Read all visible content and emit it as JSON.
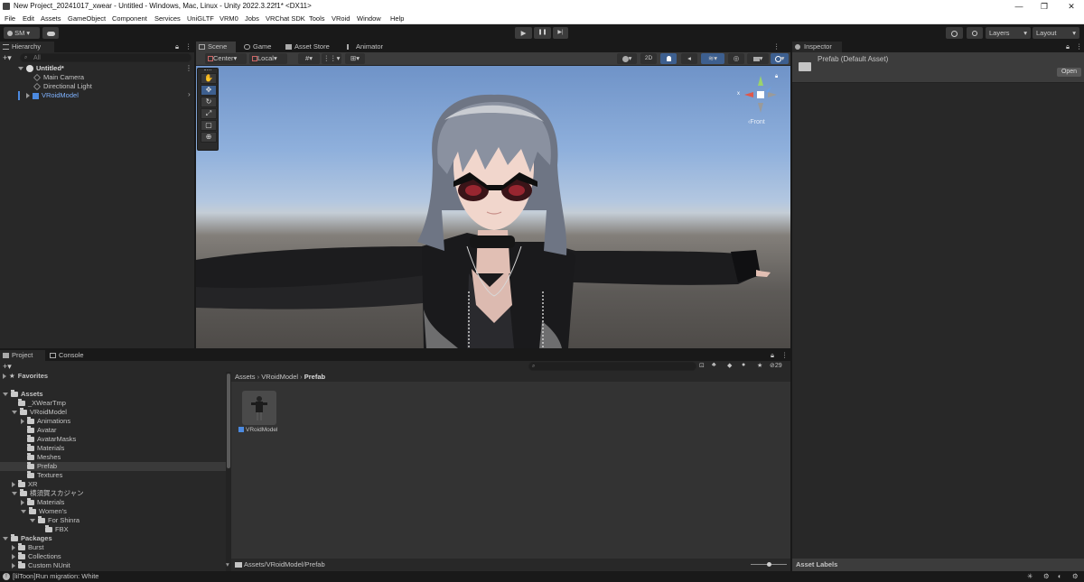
{
  "window": {
    "title": "New Project_20241017_xwear - Untitled - Windows, Mac, Linux - Unity 2022.3.22f1* <DX11>",
    "controls": [
      "—",
      "❐",
      "✕"
    ]
  },
  "menu": [
    "File",
    "Edit",
    "Assets",
    "GameObject",
    "Component",
    "Services",
    "UniGLTF",
    "VRM0",
    "Jobs",
    "VRChat SDK",
    "Tools",
    "VRoid",
    "Window",
    "Help"
  ],
  "toolbar": {
    "account": "SM",
    "cloud_icon": "cloud-icon",
    "play_icon": "▶",
    "pause_icon": "❚❚",
    "step_icon": "▶|",
    "history_icon": "history-icon",
    "search_icon": "search-icon",
    "layers": "Layers",
    "layout": "Layout"
  },
  "hierarchy": {
    "tab": "Hierarchy",
    "search_placeholder": "All",
    "scene": "Untitled*",
    "items": [
      "Main Camera",
      "Directional Light",
      "VRoidModel"
    ]
  },
  "scene_tabs": [
    "Scene",
    "Game",
    "Asset Store",
    "Animator"
  ],
  "scene_toolbar": {
    "pivot": "Center",
    "space": "Local",
    "mode_2d": "2D"
  },
  "gizmo": {
    "label": "Front",
    "x_label": "x"
  },
  "inspector": {
    "tab": "Inspector",
    "title": "Prefab (Default Asset)",
    "open_button": "Open",
    "asset_labels": "Asset Labels"
  },
  "project": {
    "tabs": [
      "Project",
      "Console"
    ],
    "favorites": "Favorites",
    "tree": [
      {
        "label": "Assets",
        "indent": 0,
        "fold": "open",
        "bold": true
      },
      {
        "label": "_XWearTmp",
        "indent": 1,
        "fold": "none"
      },
      {
        "label": "VRoidModel",
        "indent": 1,
        "fold": "open"
      },
      {
        "label": "Animations",
        "indent": 2,
        "fold": "closed"
      },
      {
        "label": "Avatar",
        "indent": 2,
        "fold": "none"
      },
      {
        "label": "AvatarMasks",
        "indent": 2,
        "fold": "none"
      },
      {
        "label": "Materials",
        "indent": 2,
        "fold": "none"
      },
      {
        "label": "Meshes",
        "indent": 2,
        "fold": "none"
      },
      {
        "label": "Prefab",
        "indent": 2,
        "fold": "none",
        "selected": true
      },
      {
        "label": "Textures",
        "indent": 2,
        "fold": "none"
      },
      {
        "label": "XR",
        "indent": 1,
        "fold": "closed"
      },
      {
        "label": "横須賀スカジャン",
        "indent": 1,
        "fold": "open"
      },
      {
        "label": "Materials",
        "indent": 2,
        "fold": "closed"
      },
      {
        "label": "Women's",
        "indent": 2,
        "fold": "open"
      },
      {
        "label": "For Shinra",
        "indent": 3,
        "fold": "open"
      },
      {
        "label": "FBX",
        "indent": 4,
        "fold": "none"
      },
      {
        "label": "Packages",
        "indent": 0,
        "fold": "open",
        "bold": true
      },
      {
        "label": "Burst",
        "indent": 1,
        "fold": "closed"
      },
      {
        "label": "Collections",
        "indent": 1,
        "fold": "closed"
      },
      {
        "label": "Custom NUnit",
        "indent": 1,
        "fold": "closed"
      }
    ],
    "breadcrumb": [
      "Assets",
      "VRoidModel",
      "Prefab"
    ],
    "asset": "VRoidModel",
    "path": "Assets/VRoidModel/Prefab",
    "hidden_count": "29"
  },
  "status": {
    "message": "[lilToon]Run migration: White"
  },
  "colors": {
    "selection_blue": "#4d7fd0",
    "accent_blue": "#4c8ae0"
  }
}
